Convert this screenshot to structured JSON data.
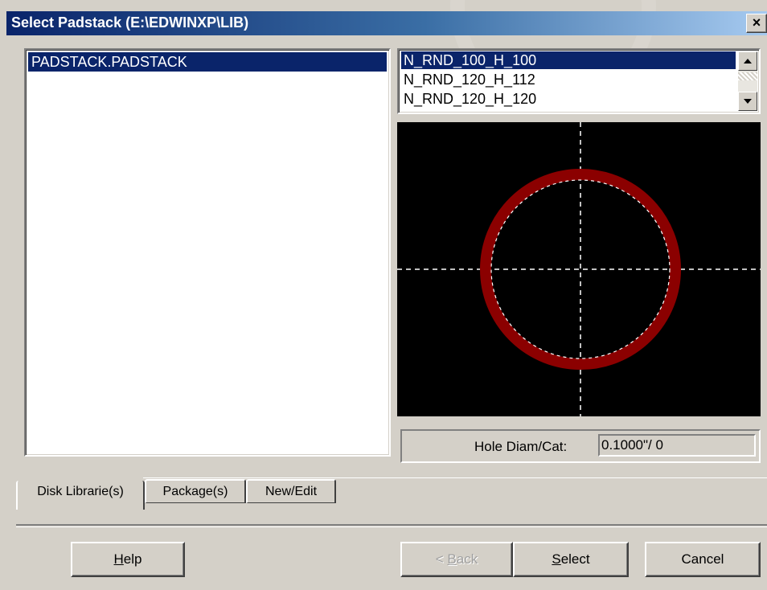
{
  "window": {
    "title": "Select Padstack (E:\\EDWINXP\\LIB)",
    "close_glyph": "×"
  },
  "library_list": {
    "items": [
      "PADSTACK.PADSTACK"
    ],
    "selected_index": 0
  },
  "padstack_list": {
    "items": [
      "N_RND_100_H_100",
      "N_RND_120_H_112",
      "N_RND_120_H_120"
    ],
    "selected_index": 0,
    "scroll_up_icon": "arrow-up-icon",
    "scroll_down_icon": "arrow-down-icon"
  },
  "preview": {
    "background": "#000000",
    "pad_color": "#8b0000",
    "crosshair_color": "#ffffff"
  },
  "hole_info": {
    "label": "Hole Diam/Cat:",
    "value": "0.1000\"/ 0"
  },
  "tabs": [
    {
      "label": "Disk Librarie(s)",
      "active": true
    },
    {
      "label": "Package(s)",
      "active": false
    },
    {
      "label": "New/Edit",
      "active": false
    }
  ],
  "buttons": {
    "help": {
      "mnemonic": "H",
      "rest": "elp"
    },
    "back": {
      "prefix": "< ",
      "mnemonic": "B",
      "rest": "ack",
      "disabled": true
    },
    "select": {
      "mnemonic": "S",
      "rest": "elect"
    },
    "cancel": {
      "label": "Cancel"
    }
  }
}
